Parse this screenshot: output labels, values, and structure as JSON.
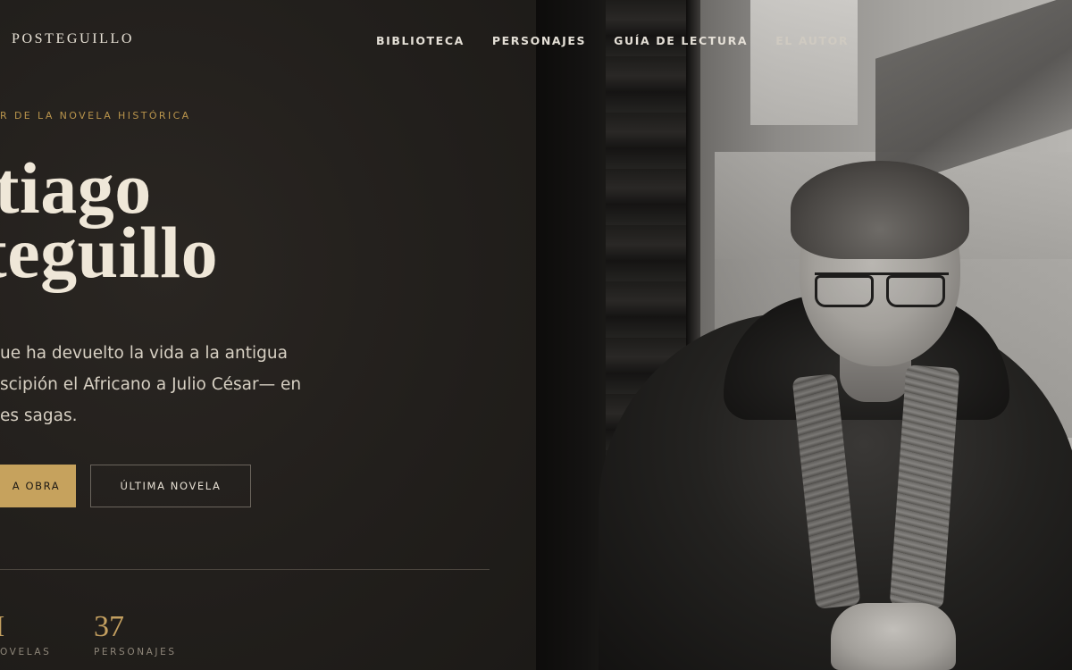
{
  "header": {
    "logo": "POSTEGUILLO",
    "nav": [
      "BIBLIOTECA",
      "PERSONAJES",
      "GUÍA DE LECTURA",
      "EL AUTOR"
    ]
  },
  "hero": {
    "eyebrow": "R DE LA NOVELA HISTÓRICA",
    "title_line1": "ntiago",
    "title_line2": "steguillo",
    "description_lines": [
      "ue ha devuelto la vida a la antigua",
      "scipión el Africano a Julio César— en",
      "es sagas."
    ],
    "primary_button": "A OBRA",
    "secondary_button": "ÚLTIMA NOVELA"
  },
  "stats": [
    {
      "number": "I",
      "label": "OVELAS"
    },
    {
      "number": "37",
      "label": "PERSONAJES"
    }
  ],
  "colors": {
    "background": "#221f1c",
    "accent": "#c6a25d",
    "title": "#efe7d8",
    "text": "#d7d0c3"
  },
  "icons": {
    "portrait": "author-portrait-photo"
  }
}
